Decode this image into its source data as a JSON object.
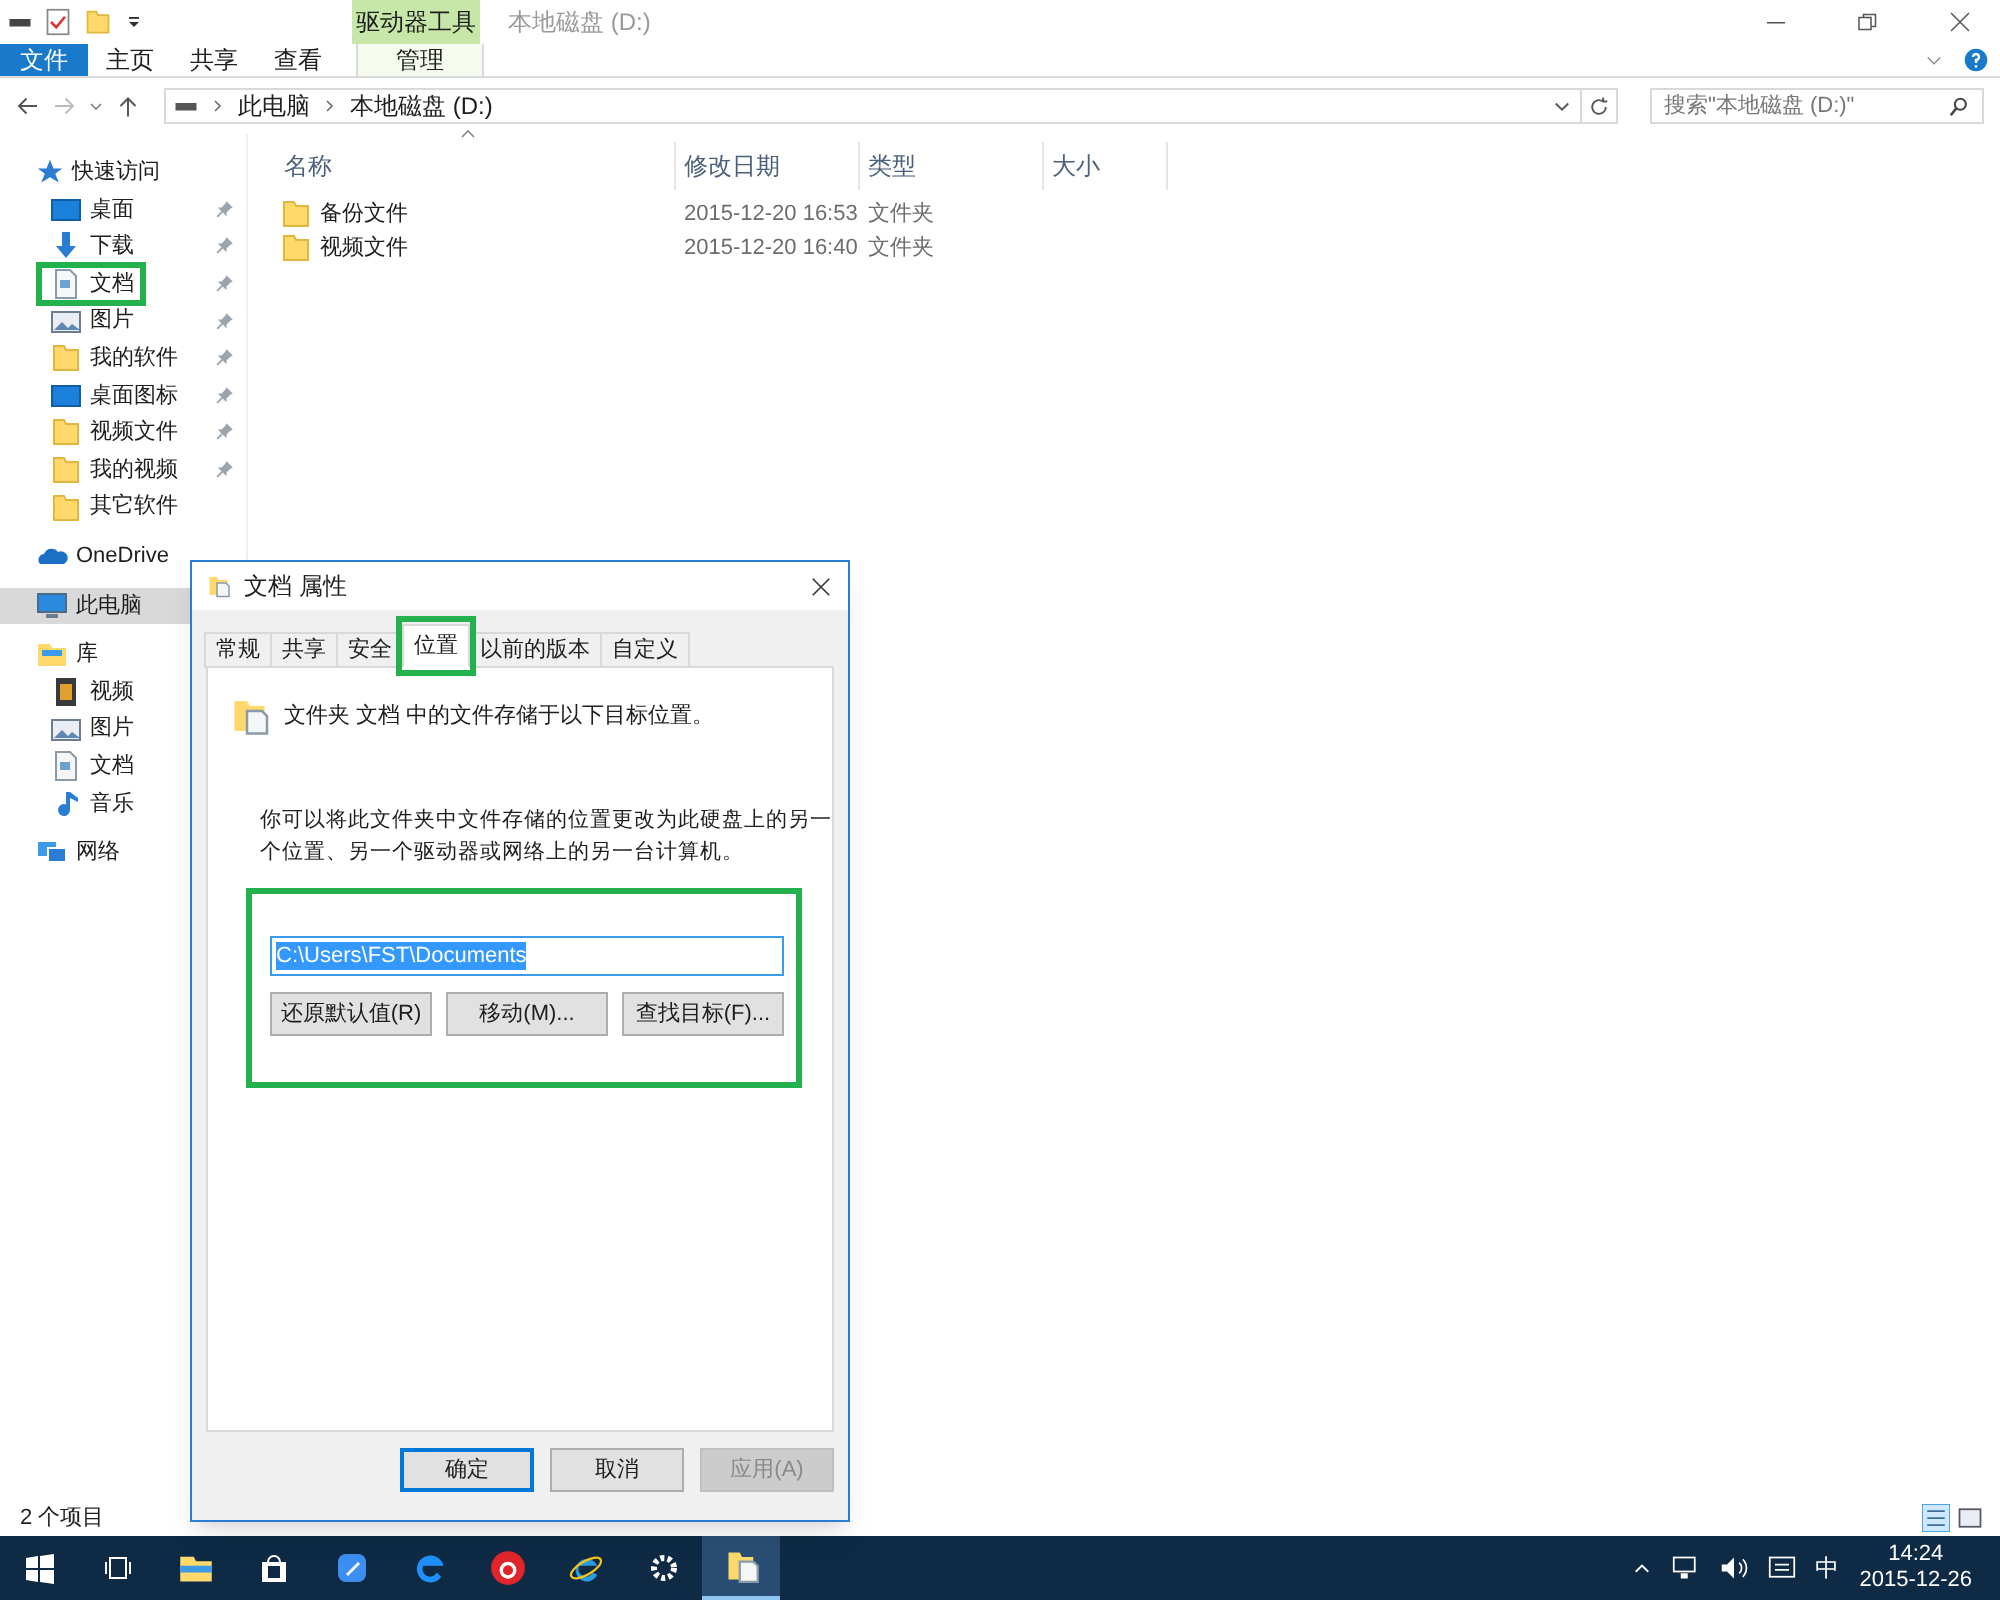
{
  "window": {
    "title": "本地磁盘 (D:)",
    "context_group": "驱动器工具"
  },
  "ribbon_tabs": [
    {
      "label": "文件",
      "kind": "file"
    },
    {
      "label": "主页",
      "kind": "plain"
    },
    {
      "label": "共享",
      "kind": "plain"
    },
    {
      "label": "查看",
      "kind": "plain"
    },
    {
      "label": "管理",
      "kind": "contextual"
    }
  ],
  "address_bar": {
    "path": [
      "此电脑",
      "本地磁盘 (D:)"
    ]
  },
  "search": {
    "placeholder": "搜索\"本地磁盘 (D:)\""
  },
  "sidebar": {
    "items": [
      {
        "label": "快速访问",
        "kind": "star",
        "selected": false,
        "highlighted": false,
        "children": [
          {
            "label": "桌面",
            "kind": "desktop",
            "pinned": true,
            "highlighted": false
          },
          {
            "label": "下载",
            "kind": "download",
            "pinned": true,
            "highlighted": false
          },
          {
            "label": "文档",
            "kind": "document",
            "pinned": true,
            "highlighted": true
          },
          {
            "label": "图片",
            "kind": "picture",
            "pinned": true,
            "highlighted": false
          },
          {
            "label": "我的软件",
            "kind": "folder",
            "pinned": true,
            "highlighted": false
          },
          {
            "label": "桌面图标",
            "kind": "desktop",
            "pinned": true,
            "highlighted": false
          },
          {
            "label": "视频文件",
            "kind": "folder",
            "pinned": true,
            "highlighted": false
          },
          {
            "label": "我的视频",
            "kind": "folder",
            "pinned": true,
            "highlighted": false
          },
          {
            "label": "其它软件",
            "kind": "folder",
            "pinned": false,
            "highlighted": false
          }
        ]
      },
      {
        "label": "OneDrive",
        "kind": "cloud",
        "selected": false,
        "highlighted": false
      },
      {
        "label": "此电脑",
        "kind": "computer",
        "selected": true,
        "highlighted": false
      },
      {
        "label": "库",
        "kind": "library",
        "selected": false,
        "highlighted": false,
        "children": [
          {
            "label": "视频",
            "kind": "video",
            "highlighted": false
          },
          {
            "label": "图片",
            "kind": "picture",
            "highlighted": false
          },
          {
            "label": "文档",
            "kind": "document",
            "highlighted": false
          },
          {
            "label": "音乐",
            "kind": "music",
            "highlighted": false
          }
        ]
      },
      {
        "label": "网络",
        "kind": "network",
        "selected": false,
        "highlighted": false
      }
    ]
  },
  "columns": [
    "名称",
    "修改日期",
    "类型",
    "大小"
  ],
  "files": [
    {
      "name": "备份文件",
      "modified": "2015-12-20 16:53",
      "type": "文件夹"
    },
    {
      "name": "视频文件",
      "modified": "2015-12-20 16:40",
      "type": "文件夹"
    }
  ],
  "status_bar": {
    "count": "2 个项目"
  },
  "dialog": {
    "title": "文档 属性",
    "tabs": [
      {
        "label": "常规",
        "selected": false,
        "highlighted": false
      },
      {
        "label": "共享",
        "selected": false,
        "highlighted": false
      },
      {
        "label": "安全",
        "selected": false,
        "highlighted": false
      },
      {
        "label": "位置",
        "selected": true,
        "highlighted": true
      },
      {
        "label": "以前的版本",
        "selected": false,
        "highlighted": false
      },
      {
        "label": "自定义",
        "selected": false,
        "highlighted": false
      }
    ],
    "heading": "文件夹 文档 中的文件存储于以下目标位置。",
    "description": "你可以将此文件夹中文件存储的位置更改为此硬盘上的另一个位置、另一个驱动器或网络上的另一台计算机。",
    "location_group": {
      "highlighted": true,
      "path": "C:\\Users\\FST\\Documents",
      "buttons": [
        "还原默认值(R)",
        "移动(M)...",
        "查找目标(F)..."
      ]
    },
    "buttons": [
      {
        "label": "确定",
        "default": true,
        "disabled": false
      },
      {
        "label": "取消",
        "default": false,
        "disabled": false
      },
      {
        "label": "应用(A)",
        "default": false,
        "disabled": true
      }
    ]
  },
  "taskbar": {
    "apps": [
      {
        "kind": "start",
        "active": false
      },
      {
        "kind": "taskview",
        "active": false
      },
      {
        "kind": "explorer",
        "active": false
      },
      {
        "kind": "store",
        "active": false
      },
      {
        "kind": "pen",
        "active": false
      },
      {
        "kind": "edge",
        "active": false
      },
      {
        "kind": "music",
        "active": false
      },
      {
        "kind": "ie",
        "active": false
      },
      {
        "kind": "settings",
        "active": false
      },
      {
        "kind": "documents",
        "active": true
      }
    ],
    "ime": "中",
    "time": "14:24",
    "date": "2015-12-26"
  }
}
